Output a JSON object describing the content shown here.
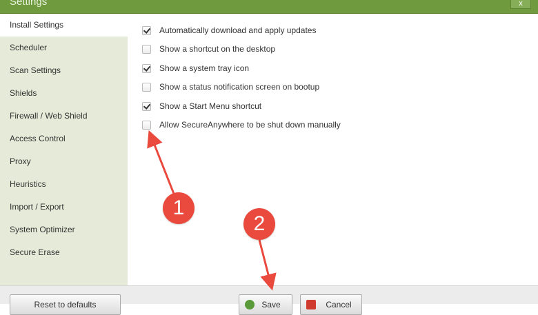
{
  "window": {
    "title": "Settings",
    "close_label": "x"
  },
  "sidebar": {
    "items": [
      {
        "label": "Install Settings",
        "active": true
      },
      {
        "label": "Scheduler"
      },
      {
        "label": "Scan Settings"
      },
      {
        "label": "Shields"
      },
      {
        "label": "Firewall / Web Shield"
      },
      {
        "label": "Access Control"
      },
      {
        "label": "Proxy"
      },
      {
        "label": "Heuristics"
      },
      {
        "label": "Import / Export"
      },
      {
        "label": "System Optimizer"
      },
      {
        "label": "Secure Erase"
      }
    ]
  },
  "options": [
    {
      "label": "Automatically download and apply updates",
      "checked": true
    },
    {
      "label": "Show a shortcut on the desktop",
      "checked": false
    },
    {
      "label": "Show a system tray icon",
      "checked": true
    },
    {
      "label": "Show a status notification screen on bootup",
      "checked": false
    },
    {
      "label": "Show a Start Menu shortcut",
      "checked": true
    },
    {
      "label": "Allow SecureAnywhere to be shut down manually",
      "checked": false
    }
  ],
  "footer": {
    "reset_label": "Reset to defaults",
    "save_label": "Save",
    "cancel_label": "Cancel"
  },
  "annotations": {
    "marker_1": "1",
    "marker_2": "2",
    "color": "#ea4a3e"
  },
  "colors": {
    "titlebar": "#6f9a3d",
    "sidebar_bg": "#e6ebd9"
  }
}
